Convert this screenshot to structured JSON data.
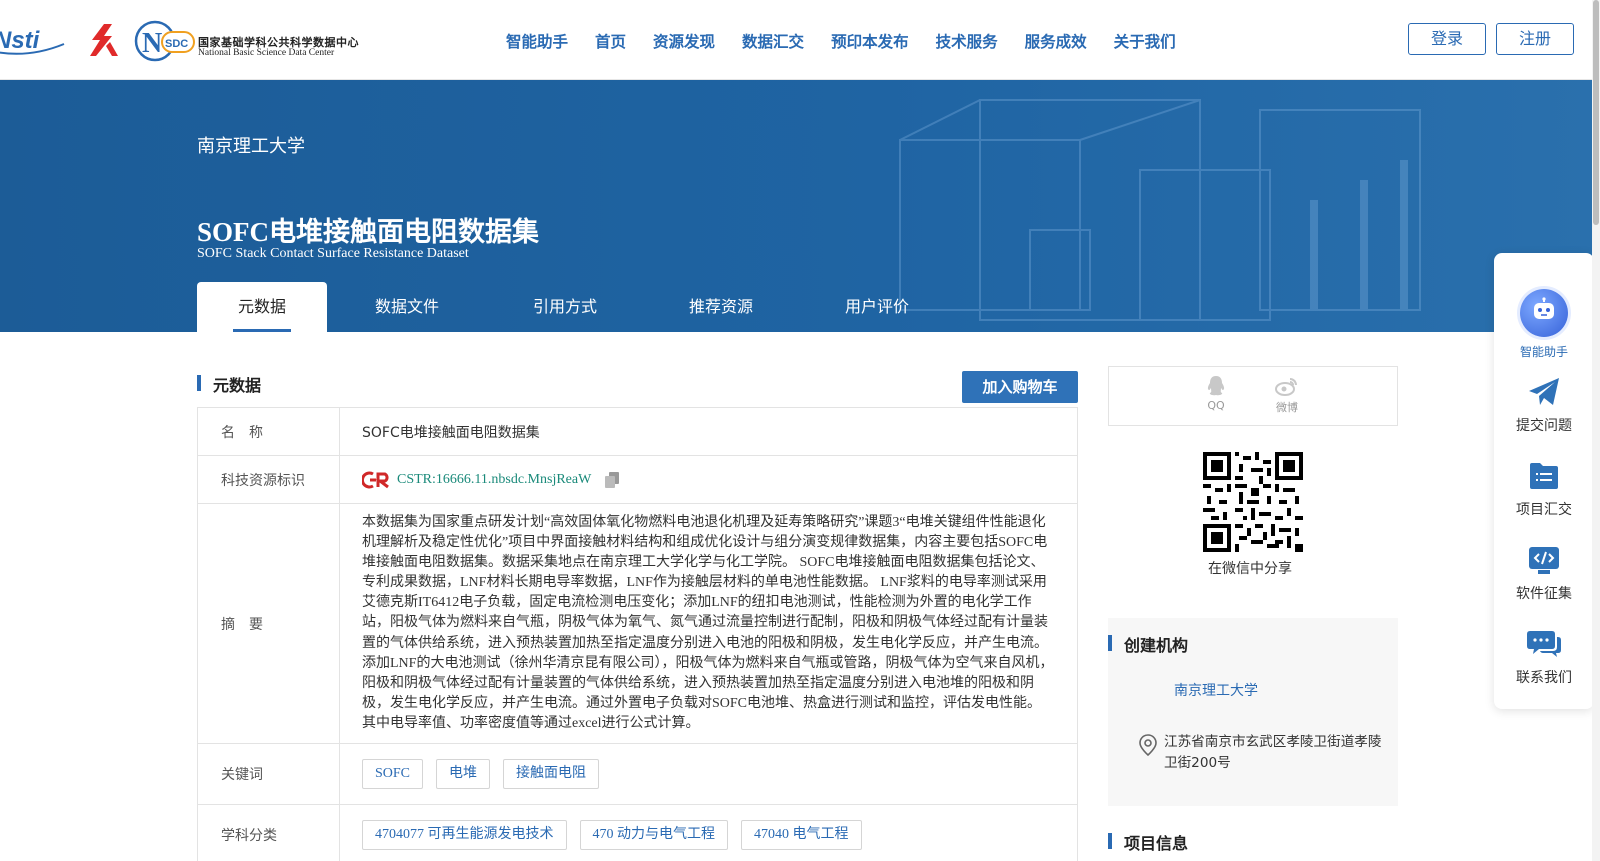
{
  "nav": {
    "logo_nsdc_cn": "国家基础学科公共科学数据中心",
    "logo_nsdc_en": "National Basic Science Data Center",
    "items": [
      "智能助手",
      "首页",
      "资源发现",
      "数据汇交",
      "预印本发布",
      "技术服务",
      "服务成效",
      "关于我们"
    ],
    "login": "登录",
    "register": "注册"
  },
  "hero": {
    "org": "南京理工大学",
    "title": "SOFC电堆接触面电阻数据集",
    "subtitle": "SOFC Stack Contact Surface Resistance Dataset",
    "tabs": [
      "元数据",
      "数据文件",
      "引用方式",
      "推荐资源",
      "用户评价"
    ]
  },
  "metadata": {
    "section_title": "元数据",
    "cart_button": "加入购物车",
    "name_label": "名　称",
    "name_value": "SOFC电堆接触面电阻数据集",
    "id_label": "科技资源标识",
    "id_value": "CSTR:16666.11.nbsdc.MnsjReaW",
    "abstract_label": "摘　要",
    "abstract": "本数据集为国家重点研发计划“高效固体氧化物燃料电池退化机理及延寿策略研究”课题3“电堆关键组件性能退化机理解析及稳定性优化”项目中界面接触材料结构和组成优化设计与组分演变规律数据集，内容主要包括SOFC电堆接触面电阻数据集。数据采集地点在南京理工大学化学与化工学院。 SOFC电堆接触面电阻数据集包括论文、专利成果数据，LNF材料长期电导率数据，LNF作为接触层材料的单电池性能数据。 LNF浆料的电导率测试采用艾德克斯IT6412电子负载，固定电流检测电压变化；添加LNF的纽扣电池测试，性能检测为外置的电化学工作站，阳极气体为燃料来自气瓶，阴极气体为氧气、氮气通过流量控制进行配制，阳极和阴极气体经过配有计量装置的气体供给系统，进入预热装置加热至指定温度分别进入电池的阳极和阴极，发生电化学反应，并产生电流。添加LNF的大电池测试（徐州华清京昆有限公司），阳极气体为燃料来自气瓶或管路，阴极气体为空气来自风机，阳极和阴极气体经过配有计量装置的气体供给系统，进入预热装置加热至指定温度分别进入电池堆的阳极和阴极，发生电化学反应，并产生电流。通过外置电子负载对SOFC电池堆、热盒进行测试和监控，评估发电性能。其中电导率值、功率密度值等通过excel进行公式计算。",
    "keywords_label": "关键词",
    "keywords": [
      "SOFC",
      "电堆",
      "接触面电阻"
    ],
    "subject_label": "学科分类",
    "subjects": [
      "4704077 可再生能源发电技术",
      "470 动力与电气工程",
      "47040 电气工程"
    ]
  },
  "share": {
    "qq": "QQ",
    "weibo": "微博",
    "qr_caption": "在微信中分享"
  },
  "org_panel": {
    "title": "创建机构",
    "name": "南京理工大学",
    "address": "江苏省南京市玄武区孝陵卫街道孝陵卫街200号"
  },
  "project": {
    "title": "项目信息"
  },
  "float_bar": {
    "ai": "智能助手",
    "submit": "提交问题",
    "collect": "项目汇交",
    "software": "软件征集",
    "contact": "联系我们"
  },
  "colors": {
    "brand_blue": "#2a6ab3",
    "hero_blue": "#1f64a3",
    "cstr_green": "#1a8a7a"
  }
}
